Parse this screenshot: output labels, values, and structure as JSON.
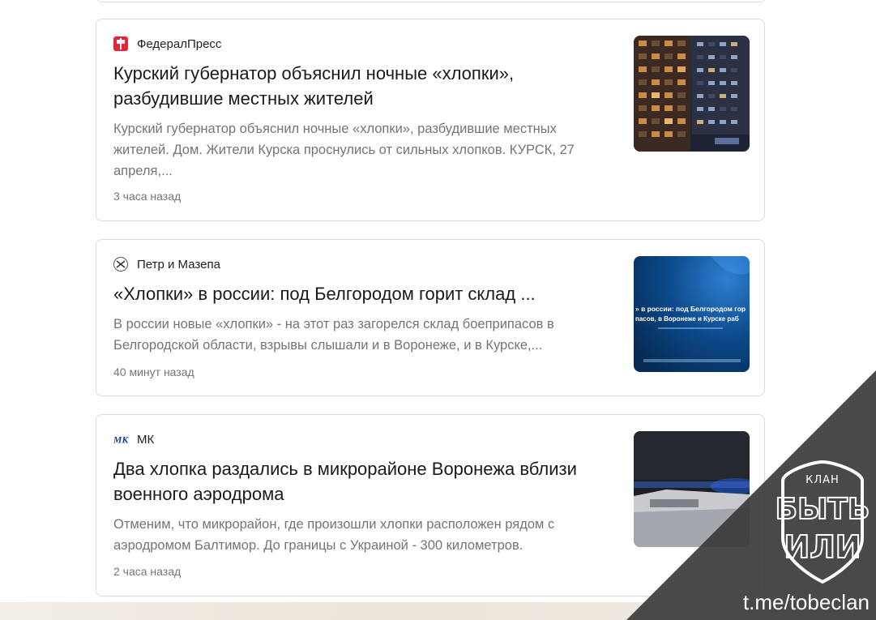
{
  "articles": [
    {
      "source": "ФедералПресс",
      "title": "Курский губернатор объяснил ночные «хлопки», разбудившие местных жителей",
      "snippet": "Курский губернатор объяснил ночные «хлопки», разбудившие местных жителей. Дом. Жители Курска проснулись от сильных хлопков. КУРСК, 27 апреля,...",
      "time": "3 часа назад",
      "logo_icon": "federalpress-logo-icon",
      "thumb_icon": "apartment-building-night-image"
    },
    {
      "source": "Петр и Мазепа",
      "title": "«Хлопки» в россии: под Белгородом горит склад ...",
      "snippet": "В россии новые «хлопки» - на этот раз загорелся склад боеприпасов в Белгородской области, взрывы слышали и в Воронеже, и в Курске,...",
      "time": "40 минут назад",
      "logo_icon": "petr-i-mazepa-logo-icon",
      "thumb_icon": "news-banner-image",
      "thumb_text": {
        "headline_1": "» в россии: под Белгородом гор",
        "headline_2": "пасов, в Воронеже и Курске раб"
      }
    },
    {
      "source": "МК",
      "title": "Два хлопка раздались в микрорайоне Воронежа вблизи военного аэродрома",
      "snippet": "Отменим, что микрорайон, где произошли хлопки расположен рядом с аэродромом Балтимор. До границы с Украиной - 300 километров.",
      "time": "2 часа назад",
      "logo_icon": "mk-logo-icon",
      "logo_text": "МК",
      "thumb_icon": "police-car-lights-image"
    }
  ],
  "watermark": {
    "emblem_top": "КЛАН",
    "emblem_mid": "БЫТЬ",
    "emblem_bottom": "ИЛИ",
    "url": "t.me/tobeclan",
    "color": "#3a3a3a"
  },
  "colors": {
    "card_border": "#dadce0",
    "title": "#1a1a1a",
    "snippet": "#70757a",
    "fp_red": "#e2263a"
  }
}
